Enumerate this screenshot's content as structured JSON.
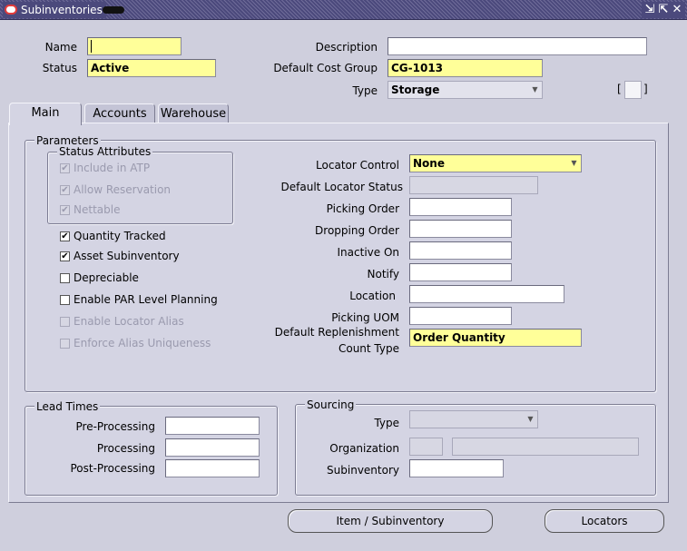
{
  "window": {
    "title": "Subinventories"
  },
  "header": {
    "name_label": "Name",
    "name_value": "",
    "status_label": "Status",
    "status_value": "Active",
    "description_label": "Description",
    "description_value": "",
    "cost_group_label": "Default Cost Group",
    "cost_group_value": "CG-1013",
    "type_label": "Type",
    "type_value": "Storage",
    "bracket_left": "[",
    "bracket_right": "]"
  },
  "tabs": [
    {
      "label": "Main",
      "active": true
    },
    {
      "label": "Accounts",
      "active": false
    },
    {
      "label": "Warehouse",
      "active": false
    }
  ],
  "parameters": {
    "title": "Parameters",
    "status_attributes": {
      "title": "Status Attributes",
      "items": [
        {
          "label": "Include in ATP",
          "checked": true,
          "enabled": false
        },
        {
          "label": "Allow Reservation",
          "checked": true,
          "enabled": false
        },
        {
          "label": "Nettable",
          "checked": true,
          "enabled": false
        }
      ]
    },
    "checkboxes": [
      {
        "label": "Quantity Tracked",
        "checked": true,
        "enabled": true
      },
      {
        "label": "Asset Subinventory",
        "checked": true,
        "enabled": true
      },
      {
        "label": "Depreciable",
        "checked": false,
        "enabled": true
      },
      {
        "label": "Enable PAR Level Planning",
        "checked": false,
        "enabled": true
      },
      {
        "label": "Enable Locator Alias",
        "checked": false,
        "enabled": false
      },
      {
        "label": "Enforce Alias Uniqueness",
        "checked": false,
        "enabled": false
      }
    ],
    "fields": {
      "locator_control_label": "Locator Control",
      "locator_control_value": "None",
      "default_locator_status_label": "Default Locator Status",
      "default_locator_status_value": "",
      "picking_order_label": "Picking Order",
      "picking_order_value": "",
      "dropping_order_label": "Dropping Order",
      "dropping_order_value": "",
      "inactive_on_label": "Inactive On",
      "inactive_on_value": "",
      "notify_label": "Notify",
      "notify_value": "",
      "location_label": "Location",
      "location_value": "",
      "picking_uom_label": "Picking UOM",
      "picking_uom_value": "",
      "replenishment_label_line1": "Default Replenishment",
      "replenishment_label_line2": "Count Type",
      "replenishment_value": "Order Quantity"
    }
  },
  "lead_times": {
    "title": "Lead Times",
    "pre_processing_label": "Pre-Processing",
    "pre_processing_value": "",
    "processing_label": "Processing",
    "processing_value": "",
    "post_processing_label": "Post-Processing",
    "post_processing_value": ""
  },
  "sourcing": {
    "title": "Sourcing",
    "type_label": "Type",
    "type_value": "",
    "organization_label": "Organization",
    "organization_code": "",
    "organization_name": "",
    "subinventory_label": "Subinventory",
    "subinventory_value": ""
  },
  "buttons": {
    "item_subinventory": "Item / Subinventory",
    "locators": "Locators"
  },
  "icons": {
    "app": "oracle-icon",
    "window": [
      "dock-icon",
      "maximize-icon",
      "close-icon"
    ],
    "dropdown": "chevron-down-icon",
    "check": "✔"
  }
}
